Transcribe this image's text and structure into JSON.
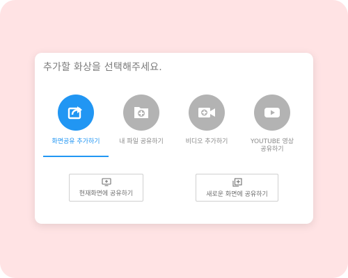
{
  "dialog": {
    "title": "추가할 화상을 선택해주세요."
  },
  "options": [
    {
      "label": "화면공유 추가하기",
      "icon": "share-screen-icon",
      "active": true
    },
    {
      "label": "내 파일 공유하기",
      "icon": "file-add-icon",
      "active": false
    },
    {
      "label": "비디오 추가하기",
      "icon": "video-add-icon",
      "active": false
    },
    {
      "label": "YOUTUBE 영상\n공유하기",
      "icon": "youtube-play-icon",
      "active": false
    }
  ],
  "buttons": {
    "current_screen": {
      "label": "현재화면에 공유하기",
      "icon": "monitor-plus-icon"
    },
    "new_screen": {
      "label": "새로운 화면에 공유하기",
      "icon": "layers-plus-icon"
    }
  },
  "colors": {
    "background": "#ffe3e4",
    "accent": "#2196f3",
    "inactive": "#b3b3b3"
  }
}
